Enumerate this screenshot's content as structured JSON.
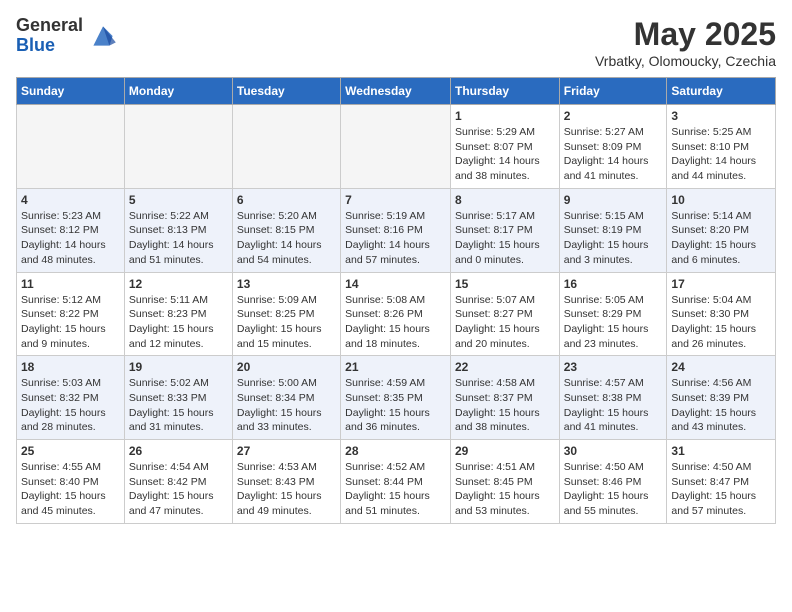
{
  "header": {
    "logo_general": "General",
    "logo_blue": "Blue",
    "month_year": "May 2025",
    "location": "Vrbatky, Olomoucky, Czechia"
  },
  "weekdays": [
    "Sunday",
    "Monday",
    "Tuesday",
    "Wednesday",
    "Thursday",
    "Friday",
    "Saturday"
  ],
  "weeks": [
    [
      {
        "day": "",
        "info": ""
      },
      {
        "day": "",
        "info": ""
      },
      {
        "day": "",
        "info": ""
      },
      {
        "day": "",
        "info": ""
      },
      {
        "day": "1",
        "info": "Sunrise: 5:29 AM\nSunset: 8:07 PM\nDaylight: 14 hours\nand 38 minutes."
      },
      {
        "day": "2",
        "info": "Sunrise: 5:27 AM\nSunset: 8:09 PM\nDaylight: 14 hours\nand 41 minutes."
      },
      {
        "day": "3",
        "info": "Sunrise: 5:25 AM\nSunset: 8:10 PM\nDaylight: 14 hours\nand 44 minutes."
      }
    ],
    [
      {
        "day": "4",
        "info": "Sunrise: 5:23 AM\nSunset: 8:12 PM\nDaylight: 14 hours\nand 48 minutes."
      },
      {
        "day": "5",
        "info": "Sunrise: 5:22 AM\nSunset: 8:13 PM\nDaylight: 14 hours\nand 51 minutes."
      },
      {
        "day": "6",
        "info": "Sunrise: 5:20 AM\nSunset: 8:15 PM\nDaylight: 14 hours\nand 54 minutes."
      },
      {
        "day": "7",
        "info": "Sunrise: 5:19 AM\nSunset: 8:16 PM\nDaylight: 14 hours\nand 57 minutes."
      },
      {
        "day": "8",
        "info": "Sunrise: 5:17 AM\nSunset: 8:17 PM\nDaylight: 15 hours\nand 0 minutes."
      },
      {
        "day": "9",
        "info": "Sunrise: 5:15 AM\nSunset: 8:19 PM\nDaylight: 15 hours\nand 3 minutes."
      },
      {
        "day": "10",
        "info": "Sunrise: 5:14 AM\nSunset: 8:20 PM\nDaylight: 15 hours\nand 6 minutes."
      }
    ],
    [
      {
        "day": "11",
        "info": "Sunrise: 5:12 AM\nSunset: 8:22 PM\nDaylight: 15 hours\nand 9 minutes."
      },
      {
        "day": "12",
        "info": "Sunrise: 5:11 AM\nSunset: 8:23 PM\nDaylight: 15 hours\nand 12 minutes."
      },
      {
        "day": "13",
        "info": "Sunrise: 5:09 AM\nSunset: 8:25 PM\nDaylight: 15 hours\nand 15 minutes."
      },
      {
        "day": "14",
        "info": "Sunrise: 5:08 AM\nSunset: 8:26 PM\nDaylight: 15 hours\nand 18 minutes."
      },
      {
        "day": "15",
        "info": "Sunrise: 5:07 AM\nSunset: 8:27 PM\nDaylight: 15 hours\nand 20 minutes."
      },
      {
        "day": "16",
        "info": "Sunrise: 5:05 AM\nSunset: 8:29 PM\nDaylight: 15 hours\nand 23 minutes."
      },
      {
        "day": "17",
        "info": "Sunrise: 5:04 AM\nSunset: 8:30 PM\nDaylight: 15 hours\nand 26 minutes."
      }
    ],
    [
      {
        "day": "18",
        "info": "Sunrise: 5:03 AM\nSunset: 8:32 PM\nDaylight: 15 hours\nand 28 minutes."
      },
      {
        "day": "19",
        "info": "Sunrise: 5:02 AM\nSunset: 8:33 PM\nDaylight: 15 hours\nand 31 minutes."
      },
      {
        "day": "20",
        "info": "Sunrise: 5:00 AM\nSunset: 8:34 PM\nDaylight: 15 hours\nand 33 minutes."
      },
      {
        "day": "21",
        "info": "Sunrise: 4:59 AM\nSunset: 8:35 PM\nDaylight: 15 hours\nand 36 minutes."
      },
      {
        "day": "22",
        "info": "Sunrise: 4:58 AM\nSunset: 8:37 PM\nDaylight: 15 hours\nand 38 minutes."
      },
      {
        "day": "23",
        "info": "Sunrise: 4:57 AM\nSunset: 8:38 PM\nDaylight: 15 hours\nand 41 minutes."
      },
      {
        "day": "24",
        "info": "Sunrise: 4:56 AM\nSunset: 8:39 PM\nDaylight: 15 hours\nand 43 minutes."
      }
    ],
    [
      {
        "day": "25",
        "info": "Sunrise: 4:55 AM\nSunset: 8:40 PM\nDaylight: 15 hours\nand 45 minutes."
      },
      {
        "day": "26",
        "info": "Sunrise: 4:54 AM\nSunset: 8:42 PM\nDaylight: 15 hours\nand 47 minutes."
      },
      {
        "day": "27",
        "info": "Sunrise: 4:53 AM\nSunset: 8:43 PM\nDaylight: 15 hours\nand 49 minutes."
      },
      {
        "day": "28",
        "info": "Sunrise: 4:52 AM\nSunset: 8:44 PM\nDaylight: 15 hours\nand 51 minutes."
      },
      {
        "day": "29",
        "info": "Sunrise: 4:51 AM\nSunset: 8:45 PM\nDaylight: 15 hours\nand 53 minutes."
      },
      {
        "day": "30",
        "info": "Sunrise: 4:50 AM\nSunset: 8:46 PM\nDaylight: 15 hours\nand 55 minutes."
      },
      {
        "day": "31",
        "info": "Sunrise: 4:50 AM\nSunset: 8:47 PM\nDaylight: 15 hours\nand 57 minutes."
      }
    ]
  ]
}
